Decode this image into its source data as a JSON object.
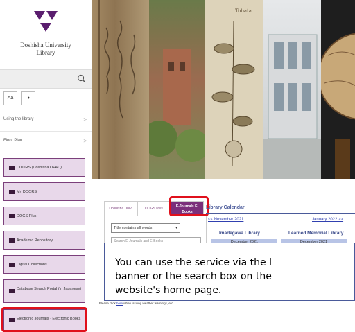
{
  "library": {
    "name_line1": "Doshisha University",
    "name_line2": "Library"
  },
  "toolbar": {
    "font_size_label": "Aa",
    "contrast_label": "◑"
  },
  "sidebar": {
    "links": [
      {
        "label": "Using the library"
      },
      {
        "label": "Floor Plan"
      }
    ],
    "buttons": [
      {
        "label": "DOORS (Doshisha OPAC)"
      },
      {
        "label": "My DOORS"
      },
      {
        "label": "DOGS Plus"
      },
      {
        "label": "Academic Repository"
      },
      {
        "label": "Digital Collections"
      },
      {
        "label": "Database Search Portal (in Japanese)"
      },
      {
        "label": "Electronic Journals · Electronic Books"
      }
    ]
  },
  "banner": {
    "caption": "Tobata"
  },
  "tabs": [
    {
      "label": "Doshisha Univ."
    },
    {
      "label": "DOGS Plus"
    },
    {
      "label": "E-Journals E-Books"
    }
  ],
  "search": {
    "select_value": "Title contains all words",
    "placeholder": "Search E-Journals and E-Books"
  },
  "calendar": {
    "title": "Library Calendar",
    "prev": "<< November 2021",
    "next": "January 2022 >>",
    "libraries": [
      {
        "name": "Imadegawa Library",
        "month": "December 2021"
      },
      {
        "name": "Learned Memorial Library",
        "month": "December 2021"
      }
    ]
  },
  "note": {
    "text": "You can use the service via the l\nbanner or the search box on the\nwebsite's home page."
  },
  "footer": {
    "pre": "Please click ",
    "link": "here",
    "post": " when issuing weather warnings, etc."
  },
  "colors": {
    "accent": "#7b2f7b",
    "highlight": "#e0101c",
    "nav_blue": "#3040b0"
  }
}
